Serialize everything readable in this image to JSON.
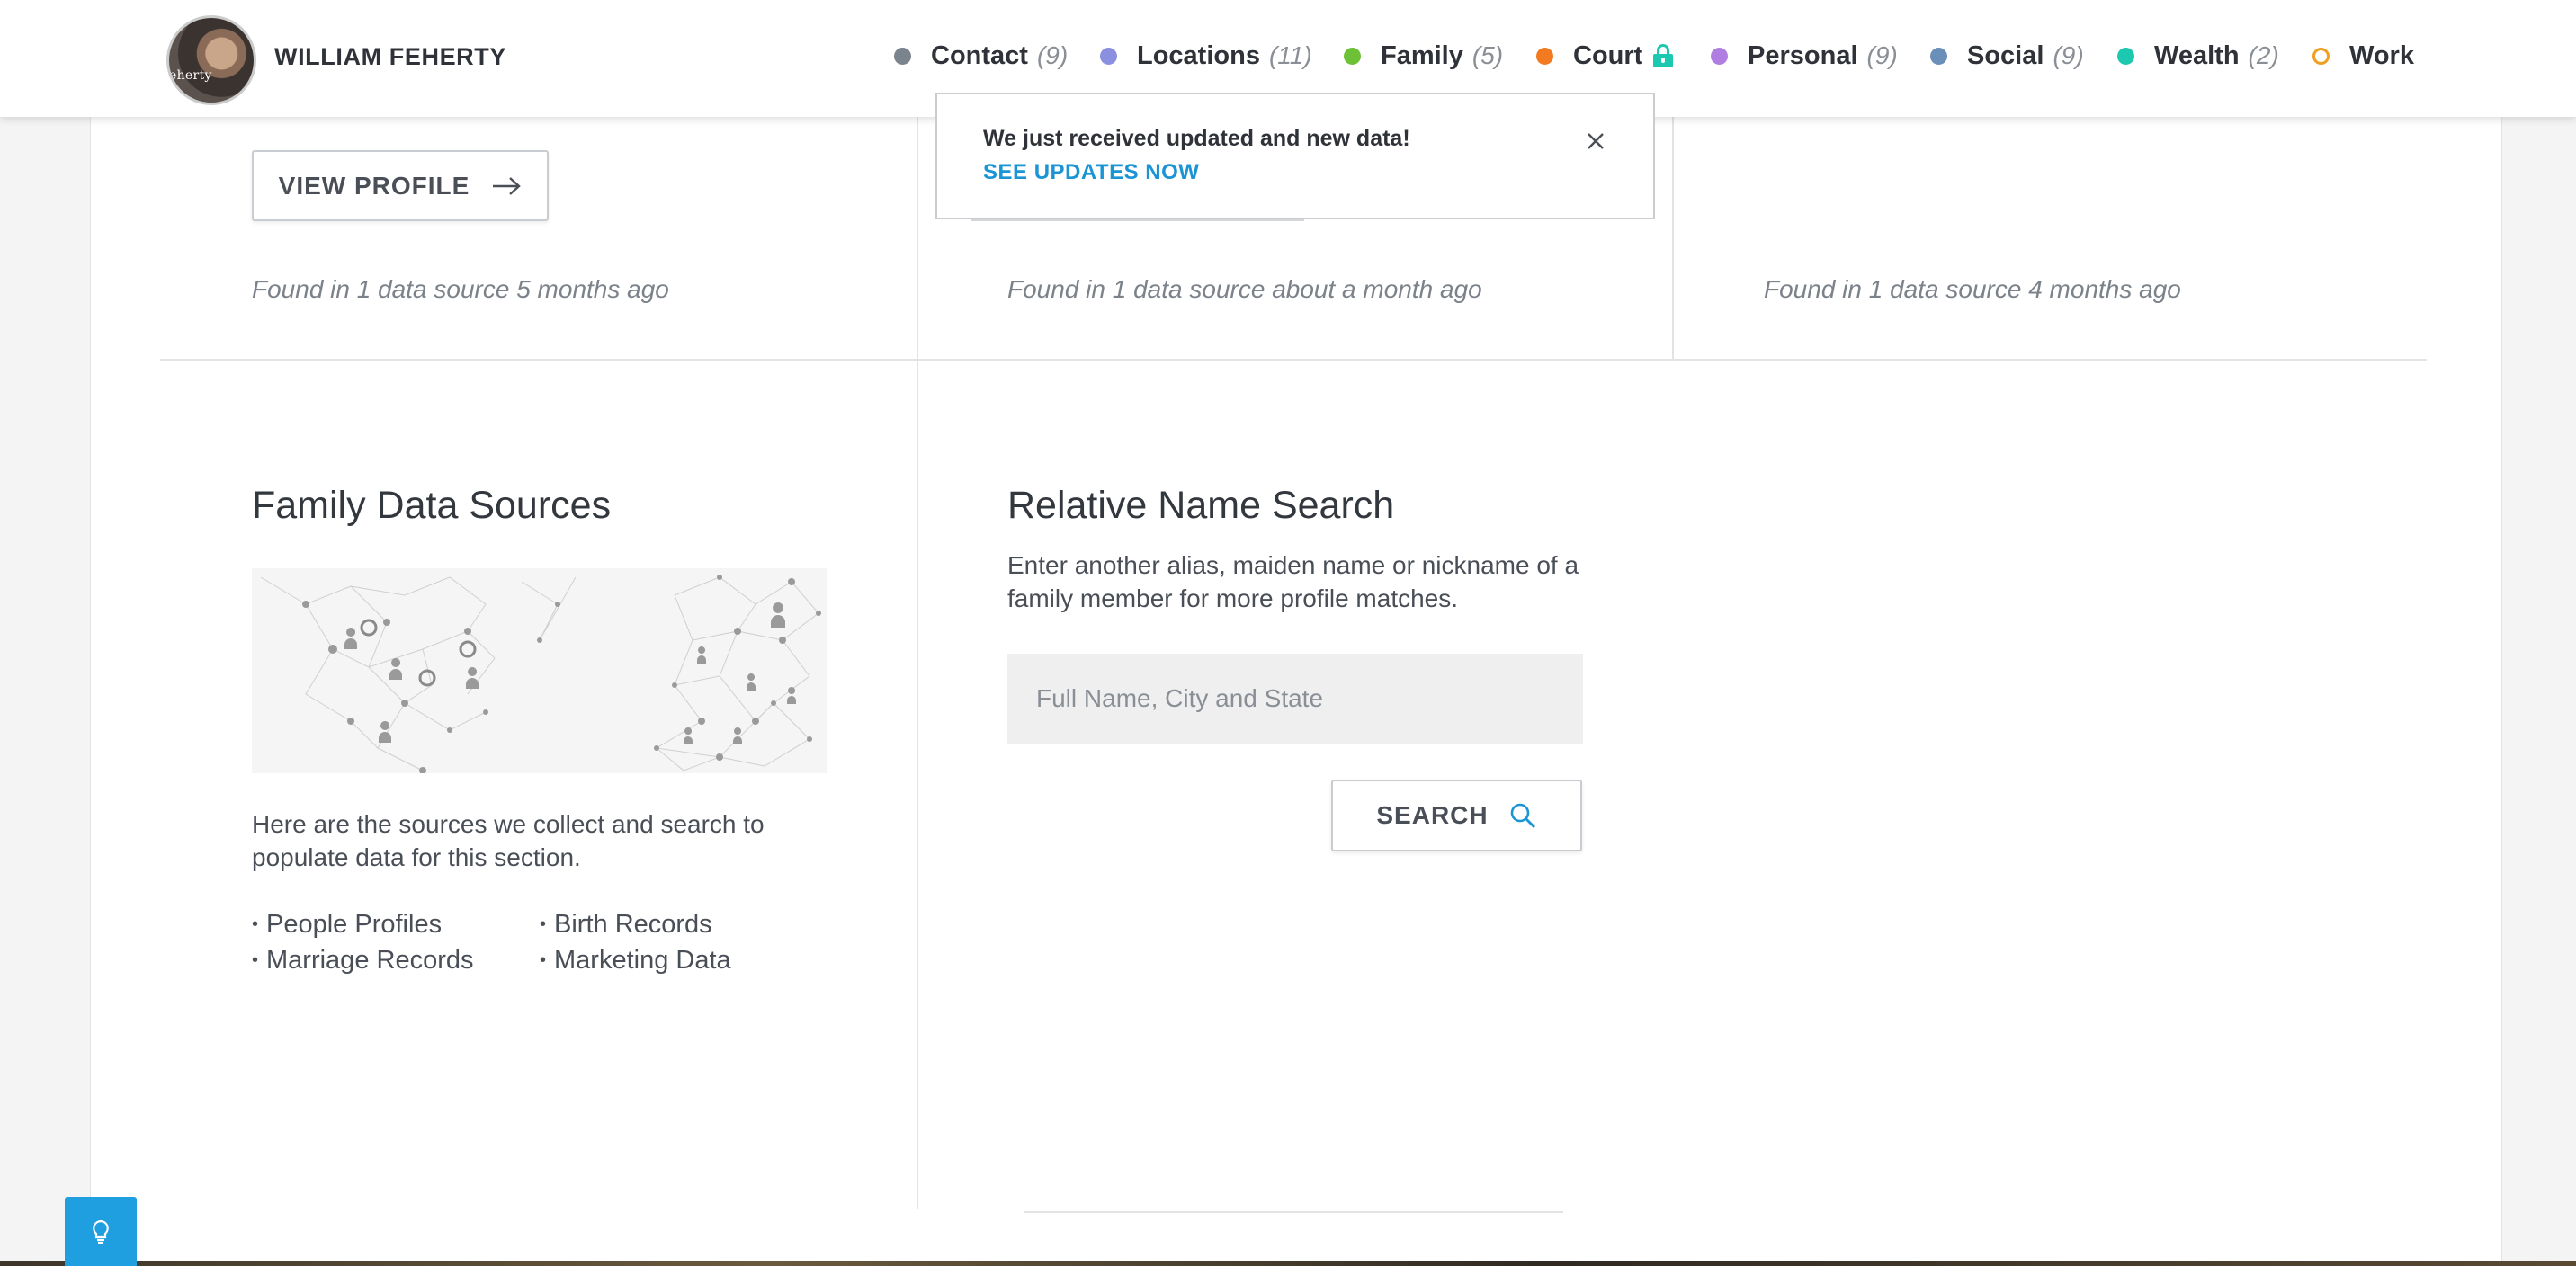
{
  "header": {
    "name": "WILLIAM FEHERTY",
    "avatar_caption": "eherty",
    "nav": [
      {
        "label": "Contact",
        "count": "(9)",
        "color": "#7b838d"
      },
      {
        "label": "Locations",
        "count": "(11)",
        "color": "#8a8fe0"
      },
      {
        "label": "Family",
        "count": "(5)",
        "color": "#6cc137"
      },
      {
        "label": "Court",
        "count": "",
        "color": "#f37a20",
        "locked": true
      },
      {
        "label": "Personal",
        "count": "(9)",
        "color": "#b07ee0"
      },
      {
        "label": "Social",
        "count": "(9)",
        "color": "#6a8fb8"
      },
      {
        "label": "Wealth",
        "count": "(2)",
        "color": "#1dc8b0"
      },
      {
        "label": "Work",
        "count": "",
        "color": "#f0a020",
        "hollow": true
      }
    ]
  },
  "notice": {
    "message": "We just received updated and new data!",
    "link": "SEE UPDATES NOW"
  },
  "cards": {
    "view_profile": "VIEW PROFILE",
    "found": [
      "Found in 1 data source 5 months ago",
      "Found in 1 data source about a month ago",
      "Found in 1 data source 4 months ago"
    ]
  },
  "family_sources": {
    "title": "Family Data Sources",
    "description": "Here are the sources we collect and search to populate data for this section.",
    "col1": [
      "People Profiles",
      "Marriage Records"
    ],
    "col2": [
      "Birth Records",
      "Marketing Data"
    ]
  },
  "relative_search": {
    "title": "Relative Name Search",
    "description": "Enter another alias, maiden name or nickname of a family member for more profile matches.",
    "placeholder": "Full Name, City and State",
    "button": "SEARCH"
  },
  "colors": {
    "accent_blue": "#1a94d4",
    "teal": "#1dc8b0",
    "help_button": "#1f9ee0"
  }
}
